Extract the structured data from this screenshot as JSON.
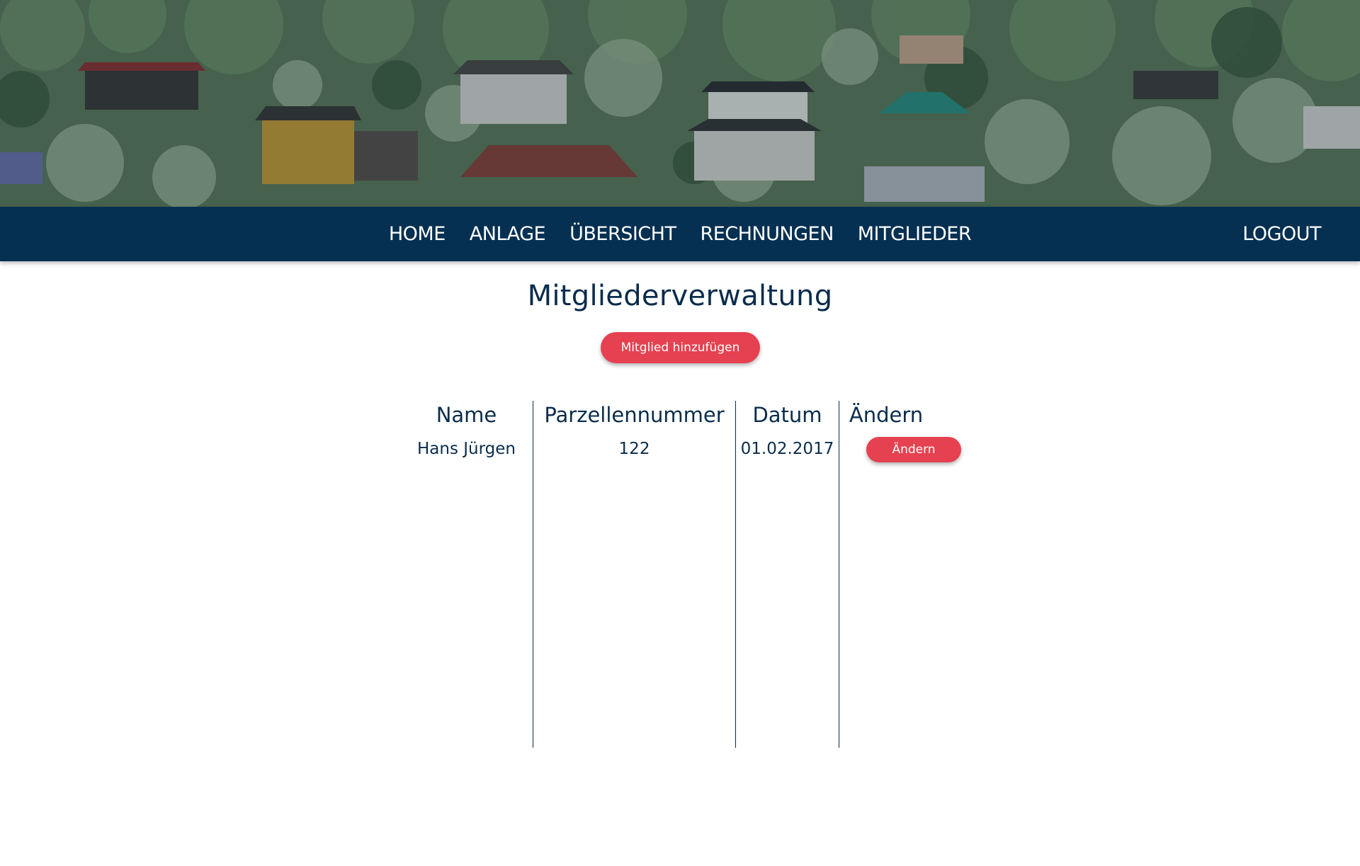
{
  "header": {
    "image_alt": "Kleingartenanlage"
  },
  "nav": {
    "items": [
      {
        "label": "HOME"
      },
      {
        "label": "ANLAGE"
      },
      {
        "label": "ÜBERSICHT"
      },
      {
        "label": "RECHNUNGEN"
      },
      {
        "label": "MITGLIEDER"
      }
    ],
    "logout_label": "LOGOUT"
  },
  "main": {
    "title": "Mitgliederverwaltung",
    "add_button_label": "Mitglied hinzufügen"
  },
  "table": {
    "columns": [
      "Name",
      "Parzellennummer",
      "Datum",
      "Ändern"
    ],
    "rows": [
      {
        "name": "Hans Jürgen",
        "parzellennummer": "122",
        "datum": "01.02.2017",
        "edit_label": "Ändern"
      }
    ]
  },
  "colors": {
    "navbar": "#063052",
    "text_primary": "#0a2c4c",
    "accent": "#e64150",
    "background": "#ffffff"
  }
}
